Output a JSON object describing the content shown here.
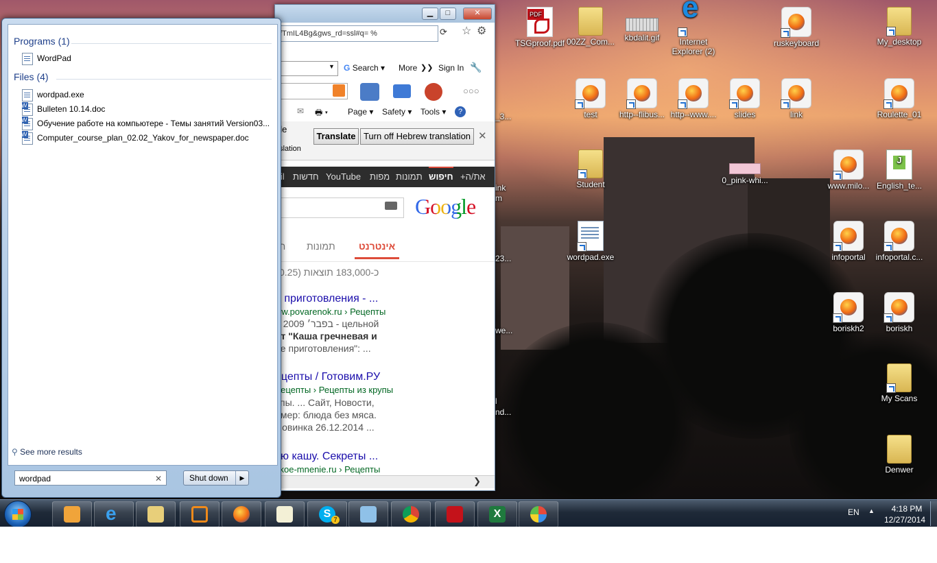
{
  "start_menu": {
    "programs_header": "Programs (1)",
    "programs": [
      {
        "label": "WordPad"
      }
    ],
    "files_header": "Files (4)",
    "files": [
      {
        "label": "wordpad.exe"
      },
      {
        "label": "Bulleten 10.14.doc"
      },
      {
        "label": "Обучение работе на компьютере - Темы занятий Version03...."
      },
      {
        "label": "Computer_course_plan_02.02_Yakov_for_newspaper.doc"
      }
    ],
    "see_more": "See more results",
    "search_value": "wordpad",
    "shutdown_label": "Shut down"
  },
  "browser": {
    "address": "gfTmIL4Bg&gws_rd=ssl#q= %",
    "toolbar": {
      "search": "Search",
      "more": "More",
      "sign_in": "Sign In"
    },
    "command_bar": {
      "page": "Page",
      "safety": "Safety",
      "tools": "Tools"
    },
    "translate": {
      "partial_lang": "gle",
      "partial_hint": "nslation",
      "translate_btn": "Translate",
      "turn_off_btn": "Turn off Hebrew translation"
    },
    "google_bar": {
      "you": "+את/ה",
      "search": "חיפוש",
      "images": "תמונות",
      "maps": "מפות",
      "youtube": "YouTube",
      "news": "חדשות",
      "more": "il"
    },
    "google_logo": "Google",
    "tabs": {
      "web": "אינטרנט",
      "images": "תמונות",
      "partial": "ח"
    },
    "result_stats": "כ-183,000 תוצאות (0.25",
    "results": [
      {
        "title": "е приготовления - ...",
        "url": "ww.povarenok.ru › Рецепты",
        "line1": "5 בפבר׳ 2009  -  цельной",
        "line2": "пт \"Каша гречневая и",
        "line3": "ее приготовления\": ..."
      },
      {
        "title": "ецепты / Готовим.РУ",
        "url": "Рецепты › Рецепты из крупы",
        "line1": "упы. ... Сайт, Новости,",
        "line2": "имер: блюда без мяса.",
        "line3": "Новинка 26.12.2014 ..."
      },
      {
        "title": "ую кашу. Секреты ...",
        "url": "skoe-mnenie.ru › Рецепты"
      }
    ]
  },
  "desktop_icons": [
    {
      "label": "TSGproof.pdf",
      "type": "pdf"
    },
    {
      "label": "00ZZ_Com...",
      "type": "folder"
    },
    {
      "label": "kbdalit.gif",
      "type": "kb"
    },
    {
      "label": "Internet Explorer (2)",
      "type": "ie"
    },
    {
      "label": "ruskeyboard",
      "type": "ff"
    },
    {
      "label": "My_desktop",
      "type": "folder"
    },
    {
      "label": "test",
      "type": "ff"
    },
    {
      "label": "http--flibus...",
      "type": "ff"
    },
    {
      "label": "http--www....",
      "type": "ff"
    },
    {
      "label": "slides",
      "type": "ff"
    },
    {
      "label": "link",
      "type": "ff"
    },
    {
      "label": "Roulette_01",
      "type": "ff"
    },
    {
      "label": "Student",
      "type": "folder"
    },
    {
      "label": "0_pink-whi...",
      "type": "pink"
    },
    {
      "label": "www.milo...",
      "type": "ff"
    },
    {
      "label": "English_te...",
      "type": "green"
    },
    {
      "label": "wordpad.exe",
      "type": "doc"
    },
    {
      "label": "infoportal",
      "type": "ff"
    },
    {
      "label": "infoportal.c...",
      "type": "ff"
    },
    {
      "label": "boriskh2",
      "type": "ff"
    },
    {
      "label": "boriskh",
      "type": "ff"
    },
    {
      "label": "My Scans",
      "type": "folder"
    },
    {
      "label": "Denwer",
      "type": "folder"
    }
  ],
  "partial_icon_labels": [
    "_3...",
    "ink",
    "m",
    "23...",
    "we...",
    "l",
    "nd..."
  ],
  "taskbar": {
    "apps": [
      "media-player-icon",
      "internet-explorer-icon",
      "file-explorer-icon",
      "office-picture-icon",
      "firefox-icon",
      "notepad-icon",
      "skype-icon",
      "wordpad-icon",
      "chrome-icon",
      "acrobat-icon",
      "excel-icon",
      "paint-icon"
    ],
    "skype_badge": "7",
    "language": "EN",
    "time": "4:18 PM",
    "date": "12/27/2014"
  },
  "colors": {
    "link": "#1a0dab",
    "url": "#006621",
    "start_header": "#1e3f8a",
    "tab_active": "#dd4b39"
  }
}
